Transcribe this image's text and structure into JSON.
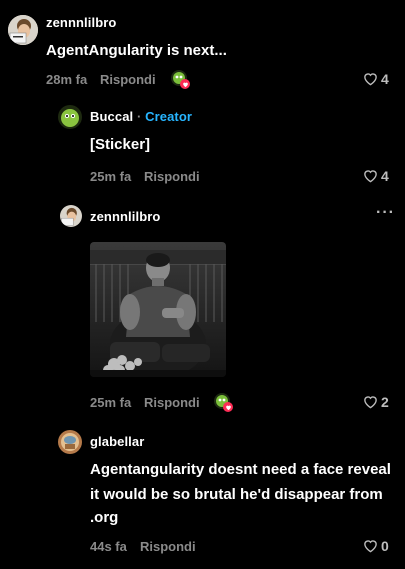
{
  "comments": [
    {
      "username": "zennnlilbro",
      "text": "AgentAngularity is next...",
      "time": "28m fa",
      "reply_label": "Rispondi",
      "likes": "4"
    },
    {
      "username": "Buccal",
      "badge_sep": "·",
      "badge": "Creator",
      "text": "[Sticker]",
      "time": "25m fa",
      "reply_label": "Rispondi",
      "likes": "4"
    },
    {
      "username": "zennnlilbro",
      "more": "···",
      "time": "25m fa",
      "reply_label": "Rispondi",
      "likes": "2"
    },
    {
      "username": "glabellar",
      "text_lines": [
        "Agentangularity doesnt need a face reveal",
        "it would be so brutal he'd disappear from",
        ".org"
      ],
      "time": "44s fa",
      "reply_label": "Rispondi",
      "likes": "0"
    }
  ],
  "colors": {
    "background": "#000000",
    "creator_badge": "#27b5ff",
    "muted": "#8a8a8a",
    "heart_badge": "#fe2c55"
  },
  "icons": [
    "heart-outline-icon",
    "more-options-icon",
    "creator-liked-badge-icon"
  ]
}
